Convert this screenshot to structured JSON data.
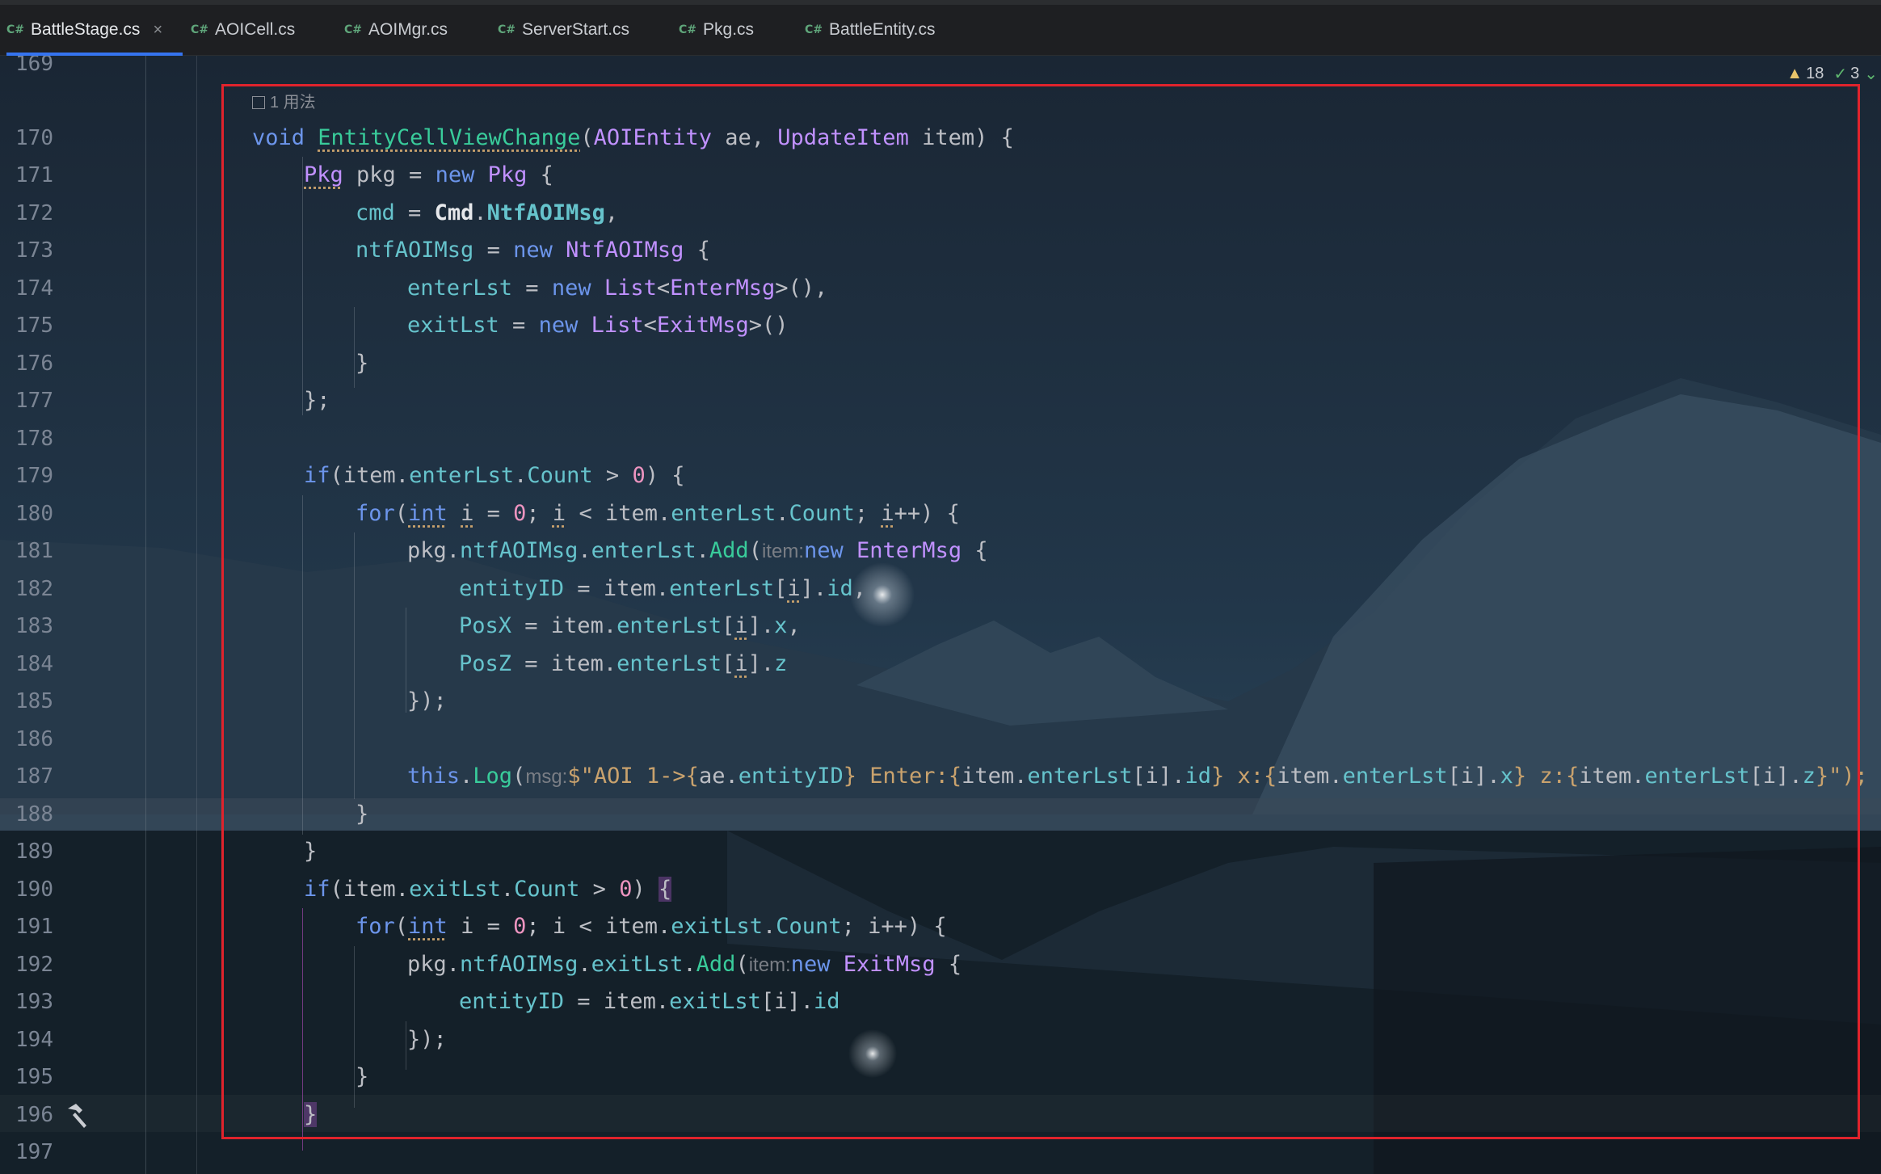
{
  "tabs": [
    {
      "label": "BattleStage.cs",
      "lang": "C#",
      "active": true,
      "close": "×"
    },
    {
      "label": "AOICell.cs",
      "lang": "C#"
    },
    {
      "label": "AOIMgr.cs",
      "lang": "C#"
    },
    {
      "label": "ServerStart.cs",
      "lang": "C#"
    },
    {
      "label": "Pkg.cs",
      "lang": "C#"
    },
    {
      "label": "BattleEntity.cs",
      "lang": "C#"
    }
  ],
  "status": {
    "warnings": "18",
    "ok": "3"
  },
  "usage_hint": "1 用法",
  "line_numbers": [
    "169",
    "170",
    "171",
    "172",
    "173",
    "174",
    "175",
    "176",
    "177",
    "178",
    "179",
    "180",
    "181",
    "182",
    "183",
    "184",
    "185",
    "186",
    "187",
    "188",
    "189",
    "190",
    "191",
    "192",
    "193",
    "194",
    "195",
    "196",
    "197"
  ],
  "code": {
    "l170": [
      "void",
      "EntityCellViewChange",
      "(",
      "AOIEntity",
      " ae, ",
      "UpdateItem",
      " item) {"
    ],
    "l171": [
      "Pkg",
      " pkg = ",
      "new",
      " ",
      "Pkg",
      " {"
    ],
    "l172": [
      "cmd",
      " = ",
      "Cmd",
      ".",
      "NtfAOIMsg",
      ","
    ],
    "l173": [
      "ntfAOIMsg",
      " = ",
      "new",
      " ",
      "NtfAOIMsg",
      " {"
    ],
    "l174": [
      "enterLst",
      " = ",
      "new",
      " ",
      "List",
      "<",
      "EnterMsg",
      ">(),"
    ],
    "l175": [
      "exitLst",
      " = ",
      "new",
      " ",
      "List",
      "<",
      "ExitMsg",
      ">()"
    ],
    "l176": [
      "}"
    ],
    "l177": [
      "};"
    ],
    "l179": [
      "if",
      "(item.",
      "enterLst",
      ".",
      "Count",
      " > ",
      "0",
      ") {"
    ],
    "l180": [
      "for",
      "(",
      "int",
      " ",
      "i",
      " = ",
      "0",
      "; ",
      "i",
      " < item.",
      "enterLst",
      ".",
      "Count",
      "; ",
      "i",
      "++) {"
    ],
    "l181": [
      "pkg.",
      "ntfAOIMsg",
      ".",
      "enterLst",
      ".",
      "Add",
      "(",
      "item:",
      "new",
      " ",
      "EnterMsg",
      " {"
    ],
    "l182": [
      "entityID",
      " = item.",
      "enterLst",
      "[",
      "i",
      "].",
      "id",
      ","
    ],
    "l183": [
      "PosX",
      " = item.",
      "enterLst",
      "[",
      "i",
      "].",
      "x",
      ","
    ],
    "l184": [
      "PosZ",
      " = item.",
      "enterLst",
      "[",
      "i",
      "].",
      "z"
    ],
    "l185": [
      "});"
    ],
    "l187": [
      "this",
      ".",
      "Log",
      "(",
      "msg:",
      "$\"AOI 1->",
      "{",
      "ae.",
      "entityID",
      "}",
      " Enter:",
      "{",
      "item.",
      "enterLst",
      "[i].",
      "id",
      "}",
      " x:",
      "{",
      "item.",
      "enterLst",
      "[i].",
      "x",
      "}",
      " z:",
      "{",
      "item.",
      "enterLst",
      "[i].",
      "z",
      "}",
      "\");"
    ],
    "l188": [
      "}"
    ],
    "l189": [
      "}"
    ],
    "l190": [
      "if",
      "(item.",
      "exitLst",
      ".",
      "Count",
      " > ",
      "0",
      ") ",
      "{"
    ],
    "l191": [
      "for",
      "(",
      "int",
      " ",
      "i",
      " = ",
      "0",
      "; ",
      "i",
      " < item.",
      "exitLst",
      ".",
      "Count",
      "; ",
      "i",
      "++) {"
    ],
    "l192": [
      "pkg.",
      "ntfAOIMsg",
      ".",
      "exitLst",
      ".",
      "Add",
      "(",
      "item:",
      "new",
      " ",
      "ExitMsg",
      " {"
    ],
    "l193": [
      "entityID",
      " = item.",
      "exitLst",
      "[",
      "i",
      "].",
      "id"
    ],
    "l194": [
      "});"
    ],
    "l195": [
      "}"
    ],
    "l196": [
      "}"
    ]
  }
}
